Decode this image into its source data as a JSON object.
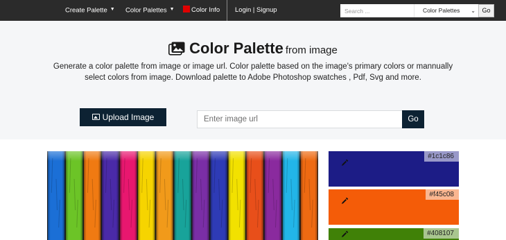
{
  "navbar": {
    "create_palette": "Create Palette",
    "color_palettes": "Color Palettes",
    "color_info": "Color Info",
    "login_signup": "Login | Signup",
    "search_placeholder": "Search ...",
    "search_type_selected": "Color Palettes",
    "go_label": "Go"
  },
  "hero": {
    "title": "Color Palette",
    "subtitle": "from image",
    "description": "Generate a color palette from image or image url. Color palette based on the image's primary colors or mannually select colors from image. Download palette to Adobe Photoshop swatches , Pdf, Svg and more.",
    "upload_label": "Upload Image",
    "url_placeholder": "Enter image url",
    "go_label": "Go"
  },
  "palette": {
    "swatches": [
      {
        "hex": "#1c1c86",
        "color": "#1c1c86"
      },
      {
        "hex": "#f45c08",
        "color": "#f45c08"
      },
      {
        "hex": "#408107",
        "color": "#408107"
      }
    ]
  },
  "colors": {
    "navbar_bg": "#2b2b2b",
    "hero_bg": "#f5f6f8",
    "button_bg": "#0d2233",
    "color_info_square": "#e00000"
  },
  "preview_image": {
    "subject": "colorful painted wooden planks",
    "plank_colors": [
      "#1b6fd6",
      "#6cc427",
      "#f07a12",
      "#4a2aa8",
      "#e8176f",
      "#f6d400",
      "#f19a1a",
      "#18a39a",
      "#7a2ea6",
      "#2e3bb6",
      "#f2e100",
      "#e84f1a",
      "#8a2a9e",
      "#22b5e8",
      "#ee6a12"
    ]
  }
}
